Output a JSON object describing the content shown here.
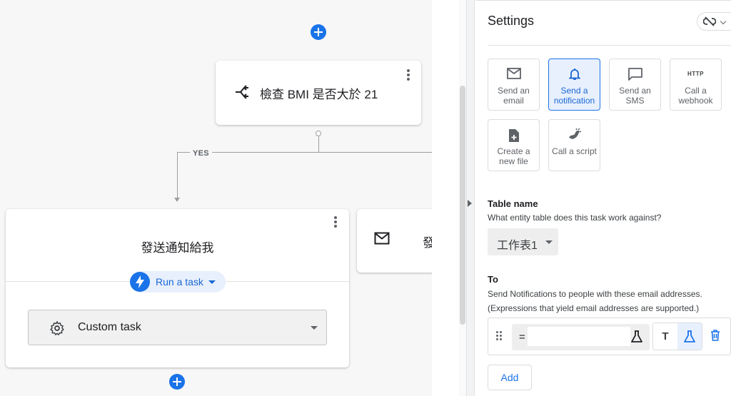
{
  "canvas": {
    "condition_step": {
      "text": "檢查 BMI 是否大於 21",
      "icon": "branch-icon"
    },
    "branch_label": "YES",
    "task_step": {
      "title": "發送通知給我",
      "action_chip": "Run a task",
      "task_select": "Custom task"
    },
    "email_step": {
      "text": "發",
      "icon": "mail-icon"
    }
  },
  "settings": {
    "title": "Settings",
    "tiles": [
      {
        "label": "Send an email",
        "icon": "mail-icon",
        "selected": false
      },
      {
        "label": "Send a notification",
        "icon": "bell-icon",
        "selected": true
      },
      {
        "label": "Send an SMS",
        "icon": "chat-bubble-icon",
        "selected": false
      },
      {
        "label": "Call a webhook",
        "icon": "http-icon",
        "icon_text": "HTTP",
        "selected": false
      },
      {
        "label": "Create a new file",
        "icon": "add-file-icon",
        "selected": false
      },
      {
        "label": "Call a script",
        "icon": "script-icon",
        "selected": false
      }
    ],
    "table_name": {
      "heading": "Table name",
      "description": "What entity table does this task work against?",
      "value": "工作表1"
    },
    "to": {
      "heading": "To",
      "description_1": "Send Notifications to people with these email addresses.",
      "description_2": "(Expressions that yield email addresses are supported.)",
      "expression_prefix": "=",
      "expression_value": "",
      "text_mode_label": "T"
    },
    "add_button": "Add"
  },
  "colors": {
    "accent": "#1a73e8",
    "accent_light": "#e8f0fe",
    "canvas_bg": "#f7f7f7"
  }
}
